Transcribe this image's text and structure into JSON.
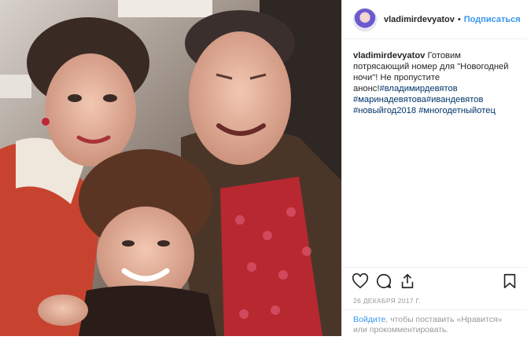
{
  "header": {
    "username": "vladimirdevyatov",
    "separator": "•",
    "follow_label": "Подписаться"
  },
  "caption": {
    "username": "vladimirdevyatov",
    "text": "Готовим потрясающий номер для \"Новогодней ночи\"! Не пропустите анонс!",
    "hashtags": [
      "#владимирдевятов",
      "#маринадевятова",
      "#ивандевятов",
      "#новыйгод2018",
      "#многодетныйотец"
    ]
  },
  "actions": {
    "icons": [
      "heart-icon",
      "comment-icon",
      "share-icon",
      "bookmark-icon"
    ]
  },
  "date": "26 ДЕКАБРЯ 2017 Г.",
  "login_prompt": {
    "link": "Войдите",
    "rest": ", чтобы поставить «Нравится» или прокомментировать."
  },
  "colors": {
    "accent": "#3897f0",
    "hashtag": "#003569",
    "muted": "#999999",
    "text": "#262626"
  }
}
